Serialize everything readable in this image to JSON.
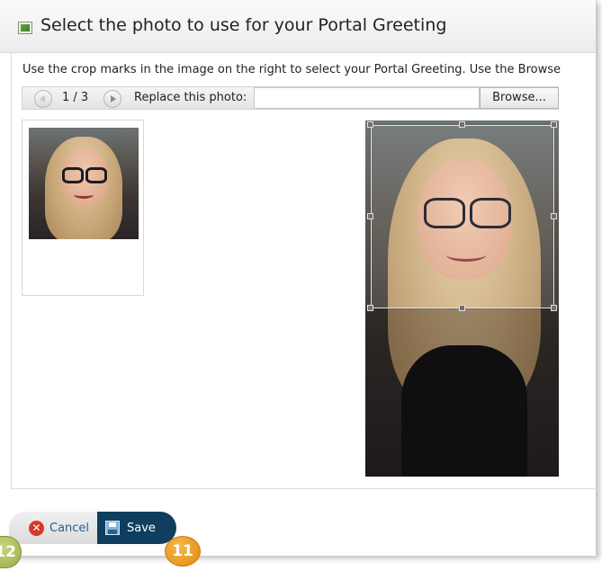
{
  "dialog": {
    "title": "Select the photo to use for your Portal Greeting",
    "instruction": "Use the crop marks in the image on the right to select your Portal Greeting. Use the Browse"
  },
  "toolbar": {
    "pager": "1 / 3",
    "replace_label": "Replace this photo:",
    "file_value": "",
    "browse_label": "Browse..."
  },
  "footer": {
    "cancel_label": "Cancel",
    "save_label": "Save"
  },
  "badges": {
    "save_step": "11",
    "cancel_step": "12"
  },
  "icons": {
    "header": "image-icon",
    "prev": "previous-arrow-icon",
    "next": "next-arrow-icon",
    "cancel": "cancel-x-icon",
    "save": "floppy-disk-icon"
  },
  "colors": {
    "save_button": "#0f3e5e",
    "cancel_text": "#2b5d8f",
    "badge_orange": "#e08a10",
    "badge_green": "#98ad48"
  }
}
